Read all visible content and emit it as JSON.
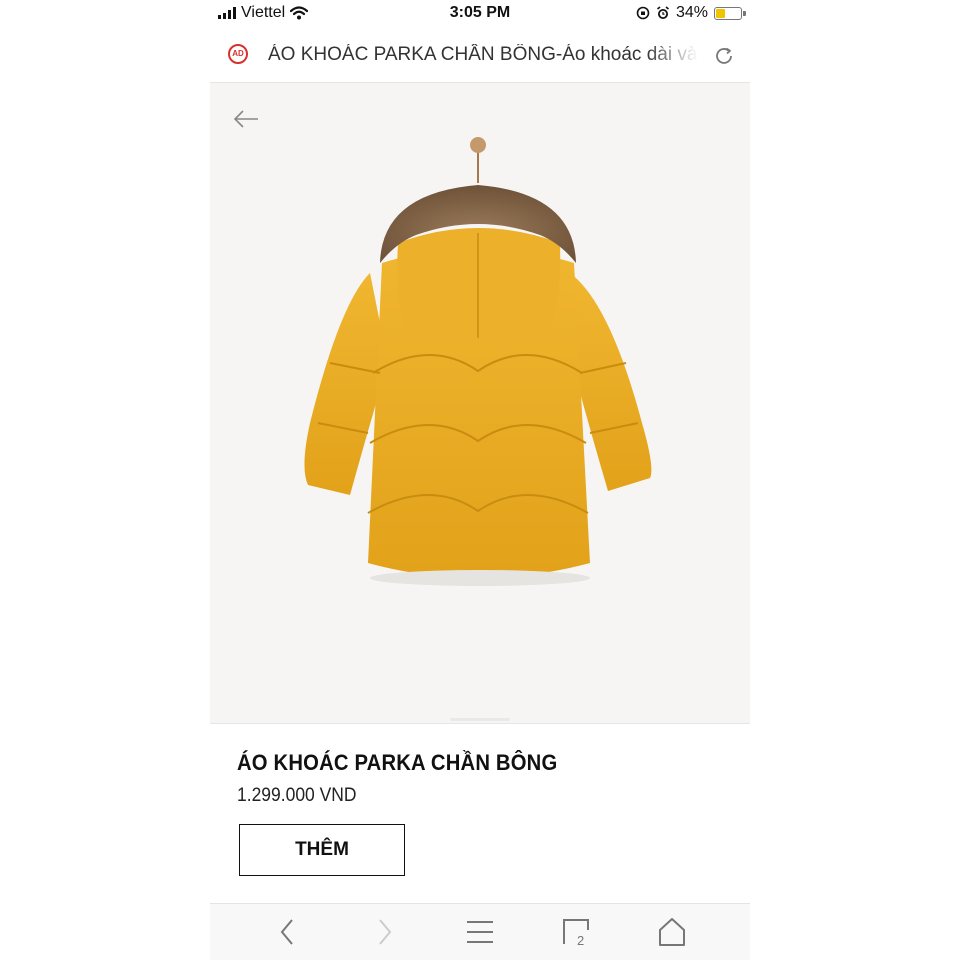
{
  "status_bar": {
    "carrier": "Viettel",
    "time": "3:05 PM",
    "battery_percent": "34%",
    "battery_level": 0.34,
    "battery_color": "#f2c400"
  },
  "browser": {
    "ad_badge": "AD",
    "url_title": "ÁO KHOÁC PARKA CHẦN BÔNG-Áo khoác dài và",
    "reload_icon": "reload-icon"
  },
  "product": {
    "back_icon": "back-arrow-icon",
    "image_subject": "jacket-image",
    "title": "ÁO KHOÁC PARKA CHẦN BÔNG",
    "price": "1.299.000 VND",
    "add_button_label": "THÊM",
    "jacket_color": "#e8a820"
  },
  "toolbar": {
    "items": [
      "back-icon",
      "forward-icon",
      "menu-icon",
      "tabs-icon",
      "home-icon"
    ],
    "tab_count": "2"
  }
}
